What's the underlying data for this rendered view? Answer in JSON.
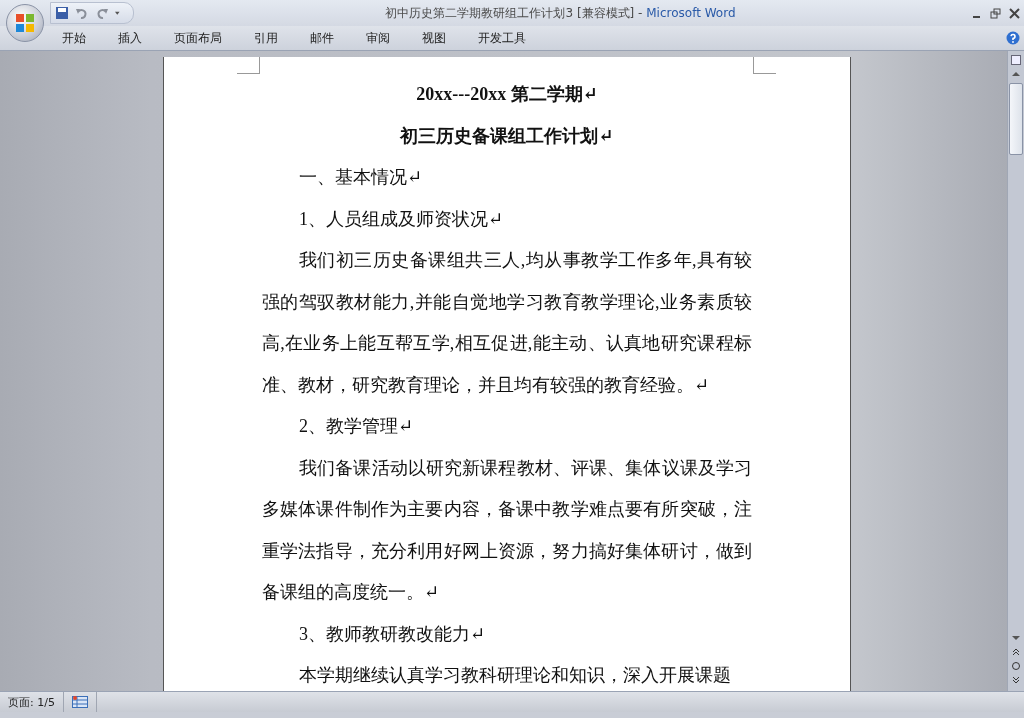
{
  "window": {
    "title": "初中历史第二学期教研组工作计划3 [兼容模式]",
    "separator": " - ",
    "app_name": "Microsoft Word"
  },
  "ribbon": {
    "tabs": [
      {
        "label": "开始",
        "selected": false
      },
      {
        "label": "插入",
        "selected": false
      },
      {
        "label": "页面布局",
        "selected": false
      },
      {
        "label": "引用",
        "selected": false
      },
      {
        "label": "邮件",
        "selected": false
      },
      {
        "label": "审阅",
        "selected": false
      },
      {
        "label": "视图",
        "selected": false
      },
      {
        "label": "开发工具",
        "selected": false
      }
    ]
  },
  "document": {
    "paragraphs": [
      {
        "kind": "title",
        "text": "20xx---20xx 第二学期↵"
      },
      {
        "kind": "title",
        "text": "初三历史备课组工作计划↵"
      },
      {
        "kind": "heading",
        "text": "一、基本情况↵"
      },
      {
        "kind": "heading",
        "text": "1、人员组成及师资状况↵"
      },
      {
        "kind": "body",
        "text": "我们初三历史备课组共三人,均从事教学工作多年,具有较强的驾驭教材能力,并能自觉地学习教育教学理论,业务素质较高,在业务上能互帮互学,相互促进,能主动、认真地研究课程标准、教材，研究教育理论，并且均有较强的教育经验。↵"
      },
      {
        "kind": "heading",
        "text": "2、教学管理↵"
      },
      {
        "kind": "body",
        "text": "我们备课活动以研究新课程教材、评课、集体议课及学习多媒体课件制作为主要内容，备课中教学难点要有所突破，注重学法指导，充分利用好网上资源，努力搞好集体研讨，做到备课组的高度统一。↵"
      },
      {
        "kind": "heading",
        "text": "3、教师教研教改能力↵"
      },
      {
        "kind": "body",
        "text": "本学期继续认真学习教科研理论和知识，深入开展课题"
      }
    ]
  },
  "status_bar": {
    "page": "页面: 1/5"
  }
}
